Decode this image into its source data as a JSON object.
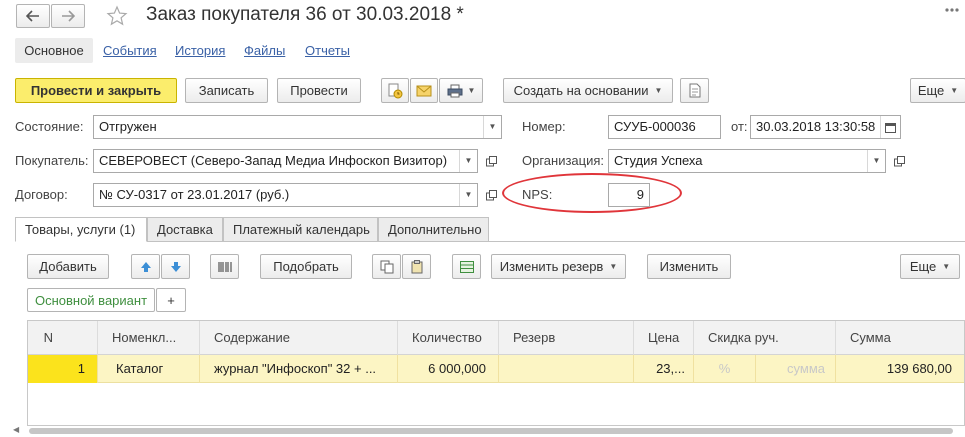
{
  "title": "Заказ покупателя 36 от 30.03.2018 *",
  "nav": {
    "main": "Основное",
    "links": [
      "События",
      "История",
      "Файлы",
      "Отчеты"
    ]
  },
  "toolbar": {
    "post_close": "Провести и закрыть",
    "save": "Записать",
    "post": "Провести",
    "create_based": "Создать на основании",
    "more": "Еще"
  },
  "form": {
    "state_label": "Состояние:",
    "state_value": "Отгружен",
    "number_label": "Номер:",
    "number_value": "СУУБ-000036",
    "date_label": "от:",
    "date_value": "30.03.2018 13:30:58",
    "buyer_label": "Покупатель:",
    "buyer_value": "СЕВЕРОВЕСТ (Северо-Запад Медиа Инфоскоп Визитор)",
    "org_label": "Организация:",
    "org_value": "Студия Успеха",
    "contract_label": "Договор:",
    "contract_value": "№ СУ-0317 от 23.01.2017 (руб.)",
    "nps_label": "NPS:",
    "nps_value": "9"
  },
  "tabs": [
    "Товары, услуги (1)",
    "Доставка",
    "Платежный календарь",
    "Дополнительно"
  ],
  "goods_toolbar": {
    "add": "Добавить",
    "pick": "Подобрать",
    "change_reserve": "Изменить резерв",
    "change": "Изменить",
    "more": "Еще"
  },
  "variant": {
    "label": "Основной вариант",
    "add": "+"
  },
  "table": {
    "headers": [
      "N",
      "Номенкл...",
      "Содержание",
      "Количество",
      "Резерв",
      "Цена",
      "Скидка руч.",
      "Сумма"
    ],
    "rows": [
      {
        "n": "1",
        "item": "Каталог",
        "content": "журнал \"Инфоскоп\" 32 + ...",
        "qty": "6 000,000",
        "reserve": "",
        "price": "23,...",
        "discount_pct": "%",
        "discount_sum": "сумма",
        "sum": "139 680,00"
      }
    ]
  },
  "colors": {
    "primary_button": "#fbed6c",
    "row_highlight": "#fcf5c4",
    "row_marker": "#fbe31c",
    "nps_highlight": "#e0353a",
    "link": "#3a61a6"
  }
}
